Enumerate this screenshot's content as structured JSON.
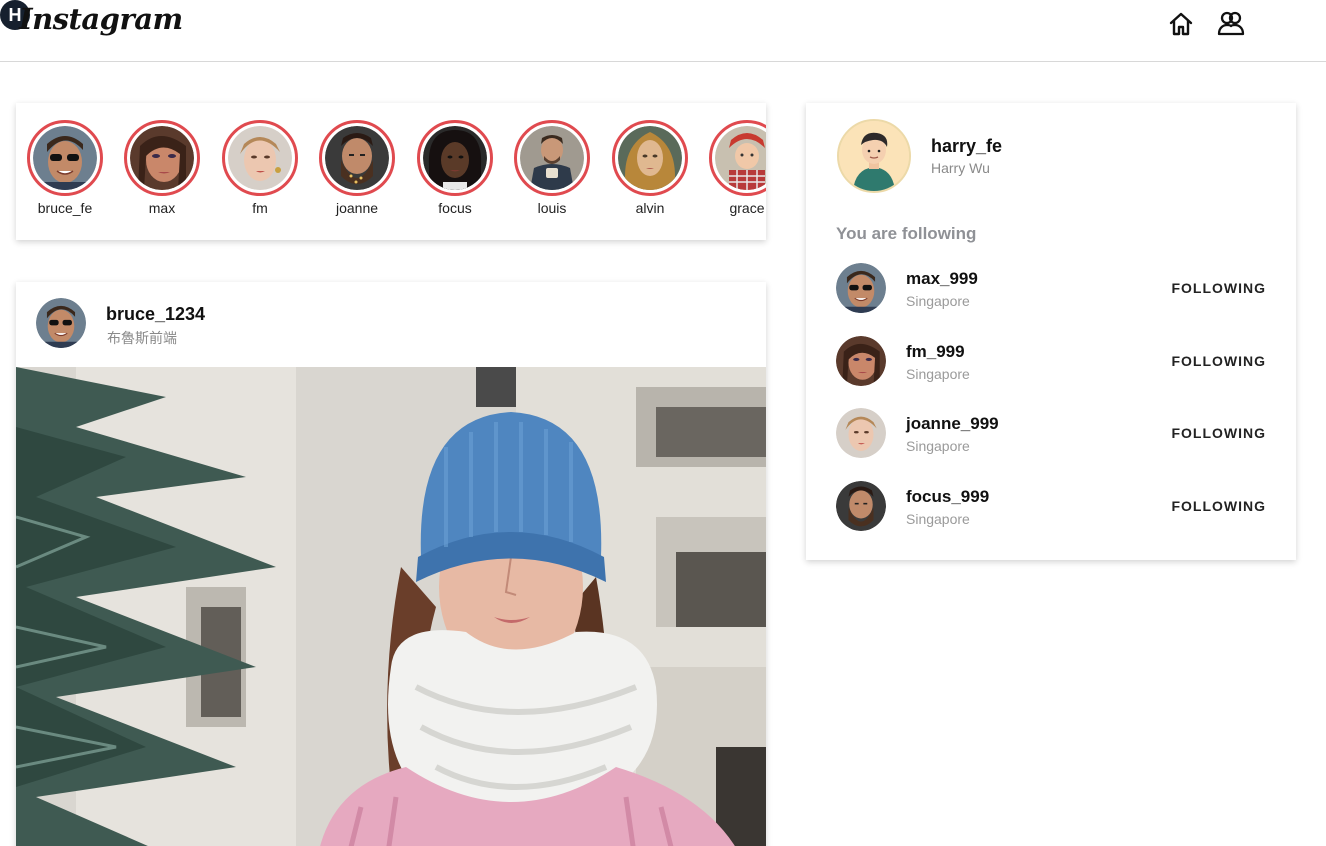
{
  "nav": {
    "logo": "Instagram",
    "home_icon": "home-icon",
    "friends_icon": "friends-icon",
    "avatar_initial": "H"
  },
  "stories": [
    {
      "name": "bruce_fe",
      "tone": "#7a5a44"
    },
    {
      "name": "max",
      "tone": "#a86a55"
    },
    {
      "name": "fm",
      "tone": "#d8b8a2"
    },
    {
      "name": "joanne",
      "tone": "#6b4a38"
    },
    {
      "name": "focus",
      "tone": "#3a2a22"
    },
    {
      "name": "louis",
      "tone": "#8a7a6c"
    },
    {
      "name": "alvin",
      "tone": "#b38a52"
    },
    {
      "name": "grace",
      "tone": "#c84a3c"
    }
  ],
  "post": {
    "user": "bruce_1234",
    "subtitle": "布魯斯前端"
  },
  "profile": {
    "username": "harry_fe",
    "name": "Harry Wu"
  },
  "following": {
    "title": "You are following",
    "items": [
      {
        "user": "max_999",
        "location": "Singapore",
        "button": "FOLLOWING",
        "tone": "#7a5a44"
      },
      {
        "user": "fm_999",
        "location": "Singapore",
        "button": "FOLLOWING",
        "tone": "#a86a55"
      },
      {
        "user": "joanne_999",
        "location": "Singapore",
        "button": "FOLLOWING",
        "tone": "#d8b8a2"
      },
      {
        "user": "focus_999",
        "location": "Singapore",
        "button": "FOLLOWING",
        "tone": "#6b4a38"
      }
    ]
  },
  "colors": {
    "story_ring": "#e04a4f",
    "nav_avatar_bg": "#16202e",
    "muted_text": "#8a8a8a"
  }
}
